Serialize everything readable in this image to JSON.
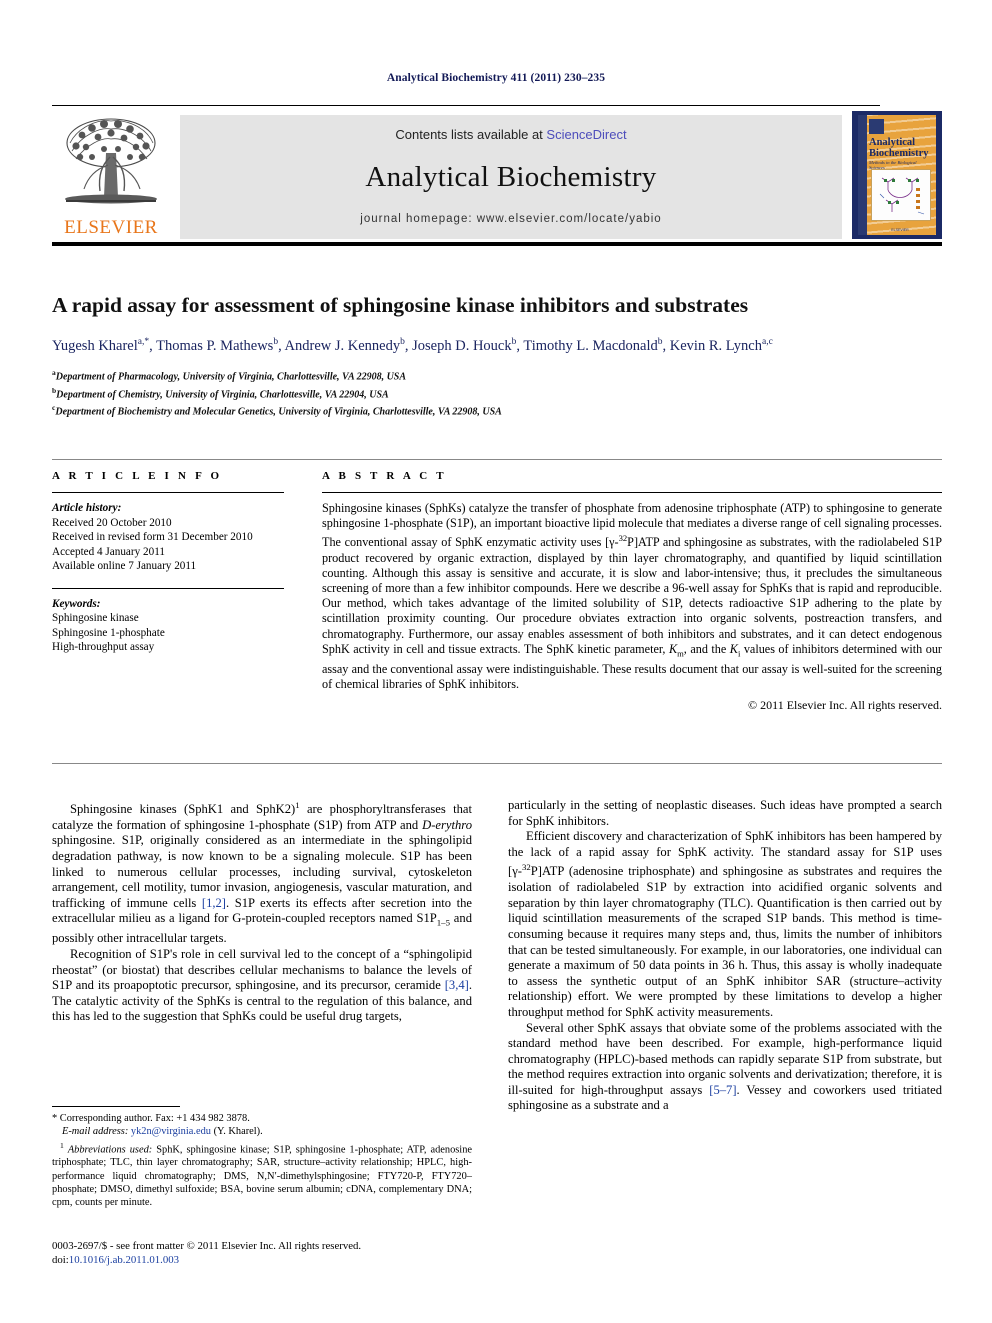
{
  "running_head": "Analytical Biochemistry 411 (2011) 230–235",
  "masthead": {
    "contents_prefix": "Contents lists available at ",
    "sciencedirect": "ScienceDirect",
    "journal_title": "Analytical Biochemistry",
    "homepage": "journal homepage: www.elsevier.com/locate/yabio",
    "publisher_wordmark": "ELSEVIER",
    "cover": {
      "title": "Analytical Biochemistry",
      "subtitle": "Methods in the Biological Sciences",
      "footer": "ELSEVIER"
    },
    "accent_orange": "#e8761b",
    "link_blue": "#4d4dbb"
  },
  "article": {
    "title": "A rapid assay for assessment of sphingosine kinase inhibitors and substrates",
    "authors": [
      {
        "name": "Yugesh Kharel",
        "marks": "a,*"
      },
      {
        "name": "Thomas P. Mathews",
        "marks": "b"
      },
      {
        "name": "Andrew J. Kennedy",
        "marks": "b"
      },
      {
        "name": "Joseph D. Houck",
        "marks": "b"
      },
      {
        "name": "Timothy L. Macdonald",
        "marks": "b"
      },
      {
        "name": "Kevin R. Lynch",
        "marks": "a,c"
      }
    ],
    "affiliations": [
      {
        "mark": "a",
        "text": "Department of Pharmacology, University of Virginia, Charlottesville, VA 22908, USA"
      },
      {
        "mark": "b",
        "text": "Department of Chemistry, University of Virginia, Charlottesville, VA 22904, USA"
      },
      {
        "mark": "c",
        "text": "Department of Biochemistry and Molecular Genetics, University of Virginia, Charlottesville, VA 22908, USA"
      }
    ]
  },
  "article_info": {
    "heading": "A R T I C L E    I N F O",
    "history_label": "Article history:",
    "history": [
      "Received 20 October 2010",
      "Received in revised form 31 December 2010",
      "Accepted 4 January 2011",
      "Available online 7 January 2011"
    ],
    "keywords_label": "Keywords:",
    "keywords": [
      "Sphingosine kinase",
      "Sphingosine 1-phosphate",
      "High-throughput assay"
    ]
  },
  "abstract": {
    "heading": "A B S T R A C T",
    "part1": "Sphingosine kinases (SphKs) catalyze the transfer of phosphate from adenosine triphosphate (ATP) to sphingosine to generate sphingosine 1-phosphate (S1P), an important bioactive lipid molecule that mediates a diverse range of cell signaling processes. The conventional assay of SphK enzymatic activity uses [γ-",
    "sup32": "32",
    "part2": "P]ATP and sphingosine as substrates, with the radiolabeled S1P product recovered by organic extraction, displayed by thin layer chromatography, and quantified by liquid scintillation counting. Although this assay is sensitive and accurate, it is slow and labor-intensive; thus, it precludes the simultaneous screening of more than a few inhibitor compounds. Here we describe a 96-well assay for SphKs that is rapid and reproducible. Our method, which takes advantage of the limited solubility of S1P, detects radioactive S1P adhering to the plate by scintillation proximity counting. Our procedure obviates extraction into organic solvents, postreaction transfers, and chromatography. Furthermore, our assay enables assessment of both inhibitors and substrates, and it can detect endogenous SphK activity in cell and tissue extracts. The SphK kinetic parameter, ",
    "km": "K",
    "km_sub": "m",
    "part3": ", and the ",
    "ki": "K",
    "ki_sub": "i",
    "part4": " values of inhibitors determined with our assay and the conventional assay were indistinguishable. These results document that our assay is well-suited for the screening of chemical libraries of SphK inhibitors.",
    "copyright": "© 2011 Elsevier Inc. All rights reserved."
  },
  "body": {
    "left": {
      "p1_a": "Sphingosine kinases (SphK1 and SphK2)",
      "p1_fnmark": "1",
      "p1_b": " are phosphoryltransferases that catalyze the formation of sphingosine 1-phosphate (S1P) from ATP and ",
      "p1_italic": "D-erythro",
      "p1_c": " sphingosine. S1P, originally considered as an intermediate in the sphingolipid degradation pathway, is now known to be a signaling molecule. S1P has been linked to numerous cellular processes, including survival, cytoskeleton arrangement, cell motility, tumor invasion, angiogenesis, vascular maturation, and trafficking of immune cells ",
      "p1_cite1": "[1,2]",
      "p1_d": ". S1P exerts its effects after secretion into the extracellular milieu as a ligand for G-protein-coupled receptors named S1P",
      "p1_sub": "1–5",
      "p1_e": " and possibly other intracellular targets.",
      "p2_a": "Recognition of S1P's role in cell survival led to the concept of a “sphingolipid rheostat” (or biostat) that describes cellular mechanisms to balance the levels of S1P and its proapoptotic precursor, sphingosine, and its precursor, ceramide ",
      "p2_cite": "[3,4]",
      "p2_b": ". The catalytic activity of the SphKs is central to the regulation of this balance, and this has led to the suggestion that SphKs could be useful drug targets,"
    },
    "right": {
      "p1": "particularly in the setting of neoplastic diseases. Such ideas have prompted a search for SphK inhibitors.",
      "p2_a": "Efficient discovery and characterization of SphK inhibitors has been hampered by the lack of a rapid assay for SphK activity. The standard assay for S1P uses [γ-",
      "p2_sup": "32",
      "p2_b": "P]ATP (adenosine triphosphate) and sphingosine as substrates and requires the isolation of radiolabeled S1P by extraction into acidified organic solvents and separation by thin layer chromatography (TLC). Quantification is then carried out by liquid scintillation measurements of the scraped S1P bands. This method is time-consuming because it requires many steps and, thus, limits the number of inhibitors that can be tested simultaneously. For example, in our laboratories, one individual can generate a maximum of 50 data points in 36 h. Thus, this assay is wholly inadequate to assess the synthetic output of an SphK inhibitor SAR (structure–activity relationship) effort. We were prompted by these limitations to develop a higher throughput method for SphK activity measurements.",
      "p3_a": "Several other SphK assays that obviate some of the problems associated with the standard method have been described. For example, high-performance liquid chromatography (HPLC)-based methods can rapidly separate S1P from substrate, but the method requires extraction into organic solvents and derivatization; therefore, it is ill-suited for high-throughput assays ",
      "p3_cite": "[5–7]",
      "p3_b": ". Vessey and coworkers used tritiated sphingosine as a substrate and a"
    }
  },
  "footnotes": {
    "corresponding_mark": "*",
    "corresponding": " Corresponding author. Fax: +1 434 982 3878.",
    "email_label": "E-mail address:",
    "email": "yk2n@virginia.edu",
    "email_suffix": " (Y. Kharel).",
    "abbrev_mark": "1",
    "abbrev_label": "Abbreviations used:",
    "abbrev_text": " SphK, sphingosine kinase; S1P, sphingosine 1-phosphate; ATP, adenosine triphosphate; TLC, thin layer chromatography; SAR, structure–activity relationship; HPLC, high-performance liquid chromatography; DMS, N,N′-dimethylsphingosine; FTY720-P, FTY720–phosphate; DMSO, dimethyl sulfoxide; BSA, bovine serum albumin; cDNA, complementary DNA; cpm, counts per minute."
  },
  "footer": {
    "issn_line": "0003-2697/$ - see front matter © 2011 Elsevier Inc. All rights reserved.",
    "doi_label": "doi:",
    "doi": "10.1016/j.ab.2011.01.003"
  }
}
